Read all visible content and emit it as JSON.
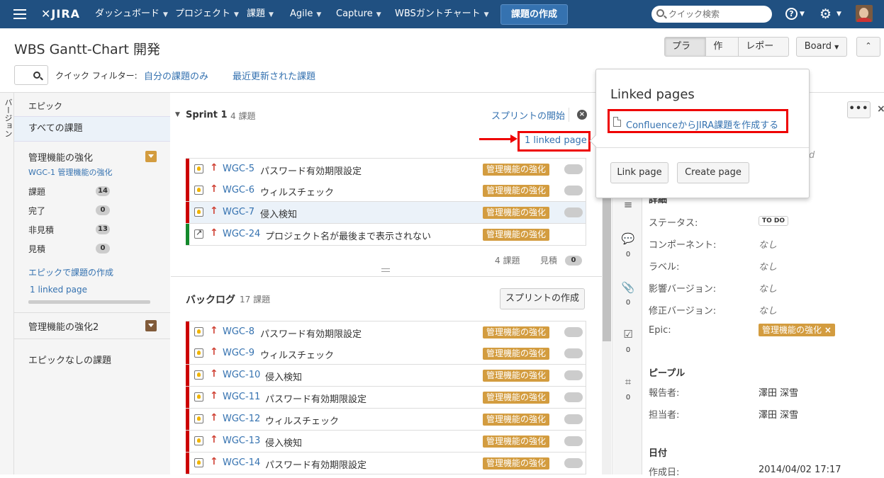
{
  "nav": {
    "logo": "JIRA",
    "items": [
      "ダッシュボード",
      "プロジェクト",
      "課題",
      "Agile",
      "Capture",
      "WBSガントチャート"
    ],
    "create_button": "課題の作成",
    "search_placeholder": "クイック検索",
    "help": "?"
  },
  "page": {
    "title": "WBS Gantt-Chart 開発",
    "modes": [
      "プラン",
      "作業",
      "レポート"
    ],
    "board_button": "Board",
    "quick_filter_label": "クイック フィルター:",
    "quick_filters": [
      "自分の課題のみ",
      "最近更新された課題"
    ]
  },
  "version_tab": "バージョン",
  "epics": {
    "header": "エピック",
    "all_issues": "すべての課題",
    "epic1": {
      "name": "管理機能の強化",
      "key": "WGC-1 管理機能の強化",
      "color": "#d39c3f",
      "stats": [
        {
          "label": "課題",
          "value": "14"
        },
        {
          "label": "完了",
          "value": "0"
        },
        {
          "label": "非見積",
          "value": "13"
        },
        {
          "label": "見積",
          "value": "0"
        }
      ],
      "create_link": "エピックで課題の作成",
      "linked_page": "1 linked page"
    },
    "epic2": {
      "name": "管理機能の強化2",
      "color": "#815b3a"
    },
    "no_epic": "エピックなしの課題"
  },
  "sprint": {
    "title": "Sprint 1",
    "count": "4 課題",
    "start_link": "スプリントの開始",
    "close": "×",
    "linked_page": "1 linked page",
    "footer_count": "4 課題",
    "footer_est_label": "見積",
    "footer_est_value": "0",
    "issues": [
      {
        "key": "WGC-5",
        "summary": "パスワード有効期限設定",
        "epic": "管理機能の強化"
      },
      {
        "key": "WGC-6",
        "summary": "ウィルスチェック",
        "epic": "管理機能の強化"
      },
      {
        "key": "WGC-7",
        "summary": "侵入検知",
        "epic": "管理機能の強化"
      },
      {
        "key": "WGC-24",
        "summary": "プロジェクト名が最後まで表示されない",
        "epic": "管理機能の強化"
      }
    ]
  },
  "backlog": {
    "title": "バックログ",
    "count": "17 課題",
    "create_sprint": "スプリントの作成",
    "issues": [
      {
        "key": "WGC-8",
        "summary": "パスワード有効期限設定",
        "epic": "管理機能の強化"
      },
      {
        "key": "WGC-9",
        "summary": "ウィルスチェック",
        "epic": "管理機能の強化"
      },
      {
        "key": "WGC-10",
        "summary": "侵入検知",
        "epic": "管理機能の強化"
      },
      {
        "key": "WGC-11",
        "summary": "パスワード有効期限設定",
        "epic": "管理機能の強化"
      },
      {
        "key": "WGC-12",
        "summary": "ウィルスチェック",
        "epic": "管理機能の強化"
      },
      {
        "key": "WGC-13",
        "summary": "侵入検知",
        "epic": "管理機能の強化"
      },
      {
        "key": "WGC-14",
        "summary": "パスワード有効期限設定",
        "epic": "管理機能の強化"
      }
    ]
  },
  "popup": {
    "title": "Linked pages",
    "create_link": "ConfluenceからJIRA課題を作成する",
    "link_page": "Link page",
    "create_page": "Create page"
  },
  "detail": {
    "more": "•••",
    "partial_text": "d",
    "section_details": "詳細",
    "counts": [
      "0",
      "0",
      "0",
      "0"
    ],
    "fields": [
      {
        "label": "ステータス:",
        "value": "TO DO"
      },
      {
        "label": "コンポーネント:",
        "value": "なし"
      },
      {
        "label": "ラベル:",
        "value": "なし"
      },
      {
        "label": "影響バージョン:",
        "value": "なし"
      },
      {
        "label": "修正バージョン:",
        "value": "なし"
      },
      {
        "label": "Epic:",
        "value": "管理機能の強化"
      }
    ],
    "section_people": "ピープル",
    "people": [
      {
        "label": "報告者:",
        "value": "澤田 深雪"
      },
      {
        "label": "担当者:",
        "value": "澤田 深雪"
      }
    ],
    "section_dates": "日付",
    "created_label": "作成日:",
    "created_value": "2014/04/02 17:17"
  }
}
